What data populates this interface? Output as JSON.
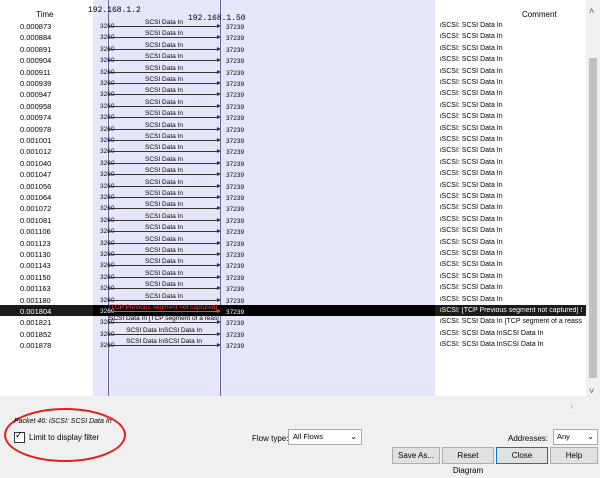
{
  "header": {
    "time": "Time",
    "ip_src": "192.168.1.2",
    "ip_dst": "192.168.1.50",
    "comment": "Comment"
  },
  "rows": [
    {
      "time": "0.000873",
      "sp": "3260",
      "label": "SCSI Data In",
      "dp": "37239",
      "comment": "iSCSI: SCSI Data In"
    },
    {
      "time": "0.000884",
      "sp": "3260",
      "label": "SCSI Data In",
      "dp": "37239",
      "comment": "iSCSI: SCSI Data In"
    },
    {
      "time": "0.000891",
      "sp": "3260",
      "label": "SCSI Data In",
      "dp": "37239",
      "comment": "iSCSI: SCSI Data In"
    },
    {
      "time": "0.000904",
      "sp": "3260",
      "label": "SCSI Data In",
      "dp": "37239",
      "comment": "iSCSI: SCSI Data In"
    },
    {
      "time": "0.000911",
      "sp": "3260",
      "label": "SCSI Data In",
      "dp": "37239",
      "comment": "iSCSI: SCSI Data In"
    },
    {
      "time": "0.000939",
      "sp": "3260",
      "label": "SCSI Data In",
      "dp": "37239",
      "comment": "iSCSI: SCSI Data In"
    },
    {
      "time": "0.000947",
      "sp": "3260",
      "label": "SCSI Data In",
      "dp": "37239",
      "comment": "iSCSI: SCSI Data In"
    },
    {
      "time": "0.000958",
      "sp": "3260",
      "label": "SCSI Data In",
      "dp": "37239",
      "comment": "iSCSI: SCSI Data In"
    },
    {
      "time": "0.000974",
      "sp": "3260",
      "label": "SCSI Data In",
      "dp": "37239",
      "comment": "iSCSI: SCSI Data In"
    },
    {
      "time": "0.000978",
      "sp": "3260",
      "label": "SCSI Data In",
      "dp": "37239",
      "comment": "iSCSI: SCSI Data In"
    },
    {
      "time": "0.001001",
      "sp": "3260",
      "label": "SCSI Data In",
      "dp": "37239",
      "comment": "iSCSI: SCSI Data In"
    },
    {
      "time": "0.001012",
      "sp": "3260",
      "label": "SCSI Data In",
      "dp": "37239",
      "comment": "iSCSI: SCSI Data In"
    },
    {
      "time": "0.001040",
      "sp": "3260",
      "label": "SCSI Data In",
      "dp": "37239",
      "comment": "iSCSI: SCSI Data In"
    },
    {
      "time": "0.001047",
      "sp": "3260",
      "label": "SCSI Data In",
      "dp": "37239",
      "comment": "iSCSI: SCSI Data In"
    },
    {
      "time": "0.001056",
      "sp": "3260",
      "label": "SCSI Data In",
      "dp": "37239",
      "comment": "iSCSI: SCSI Data In"
    },
    {
      "time": "0.001064",
      "sp": "3260",
      "label": "SCSI Data In",
      "dp": "37239",
      "comment": "iSCSI: SCSI Data In"
    },
    {
      "time": "0.001072",
      "sp": "3260",
      "label": "SCSI Data In",
      "dp": "37239",
      "comment": "iSCSI: SCSI Data In"
    },
    {
      "time": "0.001081",
      "sp": "3260",
      "label": "SCSI Data In",
      "dp": "37239",
      "comment": "iSCSI: SCSI Data In"
    },
    {
      "time": "0.001106",
      "sp": "3260",
      "label": "SCSI Data In",
      "dp": "37239",
      "comment": "iSCSI: SCSI Data In"
    },
    {
      "time": "0.001123",
      "sp": "3260",
      "label": "SCSI Data In",
      "dp": "37239",
      "comment": "iSCSI: SCSI Data In"
    },
    {
      "time": "0.001130",
      "sp": "3260",
      "label": "SCSI Data In",
      "dp": "37239",
      "comment": "iSCSI: SCSI Data In"
    },
    {
      "time": "0.001143",
      "sp": "3260",
      "label": "SCSI Data In",
      "dp": "37239",
      "comment": "iSCSI: SCSI Data In"
    },
    {
      "time": "0.001150",
      "sp": "3260",
      "label": "SCSI Data In",
      "dp": "37239",
      "comment": "iSCSI: SCSI Data In"
    },
    {
      "time": "0.001163",
      "sp": "3260",
      "label": "SCSI Data In",
      "dp": "37239",
      "comment": "iSCSI: SCSI Data In"
    },
    {
      "time": "0.001180",
      "sp": "3260",
      "label": "SCSI Data In",
      "dp": "37239",
      "comment": "iSCSI: SCSI Data In"
    },
    {
      "time": "0.001804",
      "sp": "3260",
      "label": "[TCP Previous segment not captured] S...",
      "dp": "37239",
      "comment": "iSCSI: [TCP Previous segment not captured] SCS...",
      "selected": true
    },
    {
      "time": "0.001821",
      "sp": "3260",
      "label": "SCSI Data In [TCP segment of a reass...",
      "dp": "37239",
      "comment": "iSCSI: SCSI Data In [TCP segment of a reassem..."
    },
    {
      "time": "0.001852",
      "sp": "3260",
      "label": "SCSI Data InSCSI Data In",
      "dp": "37239",
      "comment": "iSCSI: SCSI Data InSCSI Data In"
    },
    {
      "time": "0.001878",
      "sp": "3260",
      "label": "SCSI Data InSCSI Data In",
      "dp": "37239",
      "comment": "iSCSI: SCSI Data InSCSI Data In"
    }
  ],
  "footer": {
    "packet_info": "Packet 46: iSCSI: SCSI Data In",
    "limit_label": "Limit to display filter",
    "limit_checked": true,
    "flow_type_label": "Flow type:",
    "flow_type_value": "All Flows",
    "addresses_label": "Addresses:",
    "addresses_value": "Any",
    "save_as": "Save As...",
    "reset": "Reset Diagram",
    "close": "Close",
    "help": "Help"
  },
  "colors": {
    "graph_bg": "#e6e6fa",
    "selected_bg": "#1b1b1b",
    "selected_text": "#ff4040",
    "annotation": "#e02020"
  }
}
